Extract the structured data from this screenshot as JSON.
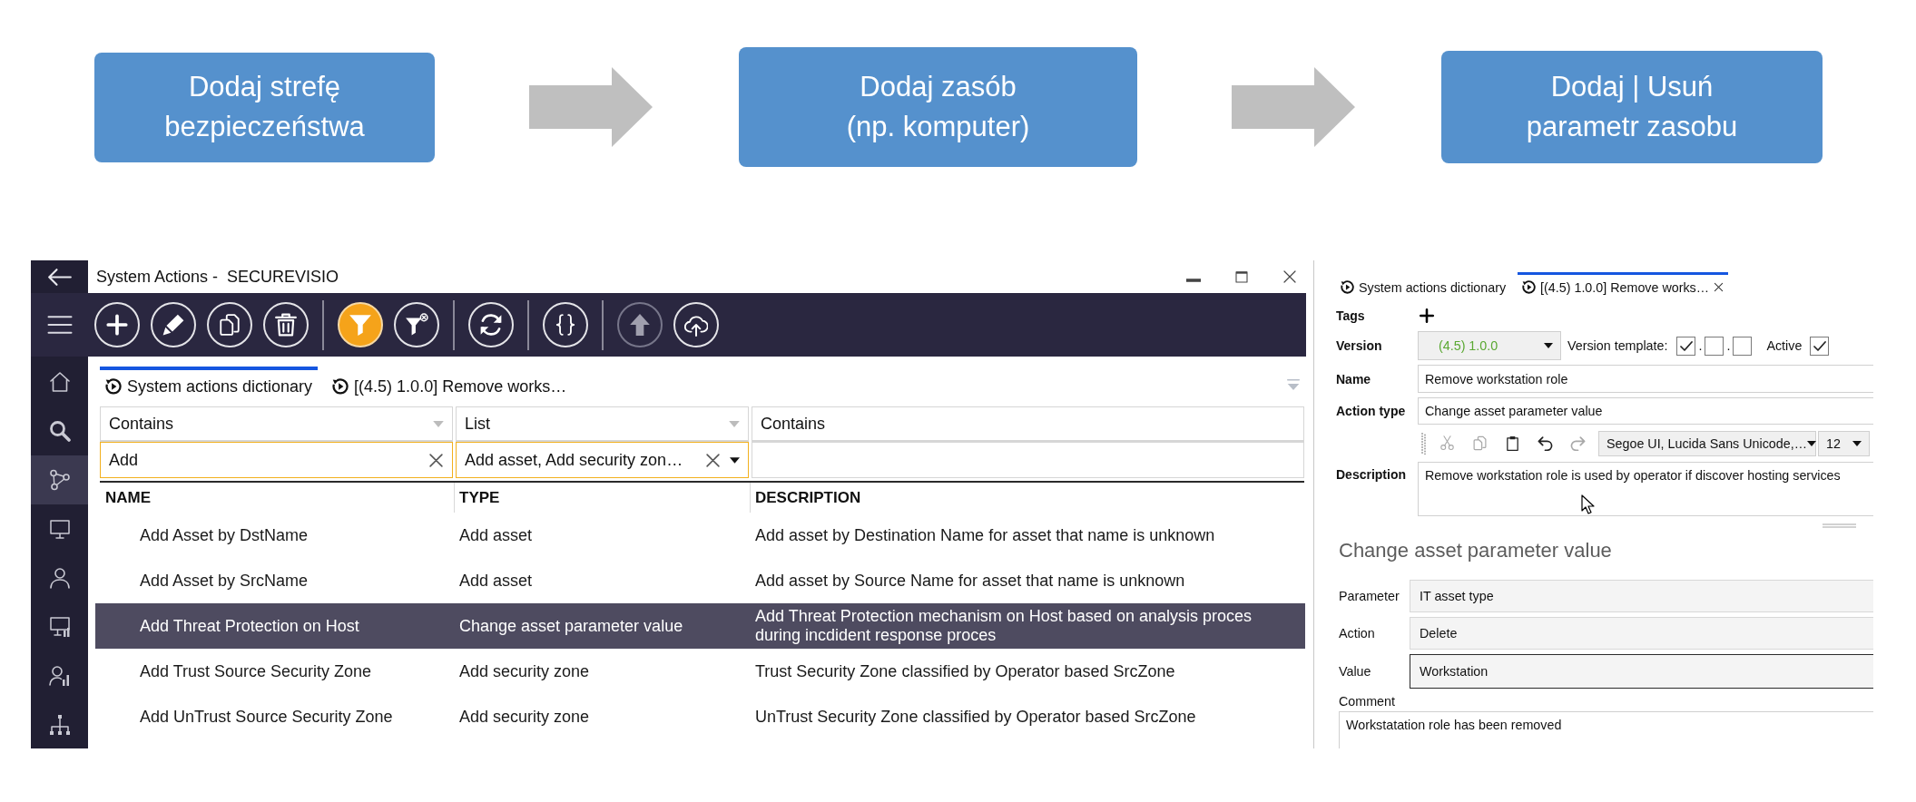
{
  "flow": {
    "steps": [
      {
        "label": "Dodaj strefę\nbezpieczeństwa"
      },
      {
        "label": "Dodaj zasób\n(np. komputer)"
      },
      {
        "label": "Dodaj | Usuń\nparametr zasobu"
      }
    ]
  },
  "app": {
    "window": {
      "title": "System Actions -  SECUREVISIO"
    },
    "nav": {
      "items": [
        {
          "kind": "home",
          "selected": false
        },
        {
          "kind": "search",
          "selected": false
        },
        {
          "kind": "network",
          "selected": true
        },
        {
          "kind": "monitor",
          "selected": false
        },
        {
          "kind": "user",
          "selected": false
        },
        {
          "kind": "monitor-chart",
          "selected": false
        },
        {
          "kind": "user-chart",
          "selected": false
        },
        {
          "kind": "hierarchy",
          "selected": false
        }
      ]
    },
    "toolbar": {
      "groups": [
        {
          "buttons": [
            {
              "kind": "add",
              "on": false,
              "disabled": false
            },
            {
              "kind": "edit",
              "on": false,
              "disabled": false
            },
            {
              "kind": "copy",
              "on": false,
              "disabled": false
            },
            {
              "kind": "delete",
              "on": false,
              "disabled": false
            }
          ]
        },
        {
          "buttons": [
            {
              "kind": "filter",
              "on": true,
              "disabled": false
            },
            {
              "kind": "clear-filter",
              "on": false,
              "disabled": false
            }
          ]
        },
        {
          "buttons": [
            {
              "kind": "refresh",
              "on": false,
              "disabled": false
            }
          ]
        },
        {
          "buttons": [
            {
              "kind": "code",
              "on": false,
              "disabled": false
            }
          ]
        },
        {
          "buttons": [
            {
              "kind": "upload",
              "on": false,
              "disabled": true
            },
            {
              "kind": "cloud-upload",
              "on": false,
              "disabled": false
            }
          ]
        }
      ]
    },
    "tabs": [
      {
        "label": "System actions dictionary",
        "selected": true,
        "closable": false
      },
      {
        "label": "[(4.5) 1.0.0] Remove works…",
        "selected": false,
        "closable": false
      }
    ],
    "filters": [
      {
        "kind": "text",
        "operator": "Contains",
        "value": "Add",
        "active": true
      },
      {
        "kind": "list",
        "operator": "List",
        "value": "Add asset, Add security zon…",
        "active": true
      },
      {
        "kind": "text",
        "operator": "Contains",
        "active": false
      }
    ],
    "table": {
      "columns": [
        "NAME",
        "TYPE",
        "DESCRIPTION"
      ],
      "rows": [
        {
          "cells": [
            "Add Asset by DstName",
            "Add asset",
            "Add asset by Destination Name for asset that name is unknown"
          ],
          "selected": false
        },
        {
          "cells": [
            "Add Asset by SrcName",
            "Add asset",
            "Add asset by Source Name for asset that name is unknown"
          ],
          "selected": false
        },
        {
          "cells": [
            "Add Threat Protection on Host",
            "Change asset parameter value",
            "Add Threat Protection mechanism on Host based on analysis proces during incdident response proces"
          ],
          "selected": true
        },
        {
          "cells": [
            "Add Trust Source Security Zone",
            "Add security zone",
            "Trust Security Zone classified by Operator based SrcZone"
          ],
          "selected": false
        },
        {
          "cells": [
            "Add UnTrust Source Security Zone",
            "Add security zone",
            "UnTrust Security Zone classified by Operator based SrcZone"
          ],
          "selected": false
        }
      ]
    }
  },
  "detail": {
    "tabs": [
      {
        "label": "System actions dictionary",
        "selected": false,
        "closable": false
      },
      {
        "label": "[(4.5) 1.0.0] Remove works…",
        "selected": true,
        "closable": true
      }
    ],
    "tags": {
      "label": "Tags"
    },
    "version": {
      "label": "Version",
      "value": "(4.5) 1.0.0",
      "template_label": "Version template:",
      "separator": ".",
      "template": [
        {
          "checked": true
        },
        {
          "checked": false
        },
        {
          "checked": false
        }
      ],
      "active": {
        "label": "Active",
        "checked": true
      }
    },
    "name": {
      "label": "Name",
      "value": "Remove workstation role"
    },
    "action_type": {
      "label": "Action type",
      "value": "Change asset parameter value"
    },
    "editor": {
      "buttons": [
        {
          "kind": "cut",
          "disabled": true
        },
        {
          "kind": "copy",
          "disabled": true
        },
        {
          "kind": "paste",
          "disabled": false
        },
        {
          "kind": "undo",
          "disabled": false
        },
        {
          "kind": "redo",
          "disabled": true
        }
      ],
      "font": "Segoe UI, Lucida Sans Unicode,…",
      "size": "12"
    },
    "description": {
      "label": "Description",
      "value": "Remove workstation role is used by operator if discover hosting services"
    },
    "section": {
      "title": "Change asset parameter value",
      "params": [
        {
          "label": "Parameter",
          "value": "IT asset type",
          "focused": false
        },
        {
          "label": "Action",
          "value": "Delete",
          "focused": false
        },
        {
          "label": "Value",
          "value": "Workstation",
          "focused": true
        }
      ],
      "comment": {
        "label": "Comment",
        "value": "Workstatation role has been removed"
      }
    }
  }
}
